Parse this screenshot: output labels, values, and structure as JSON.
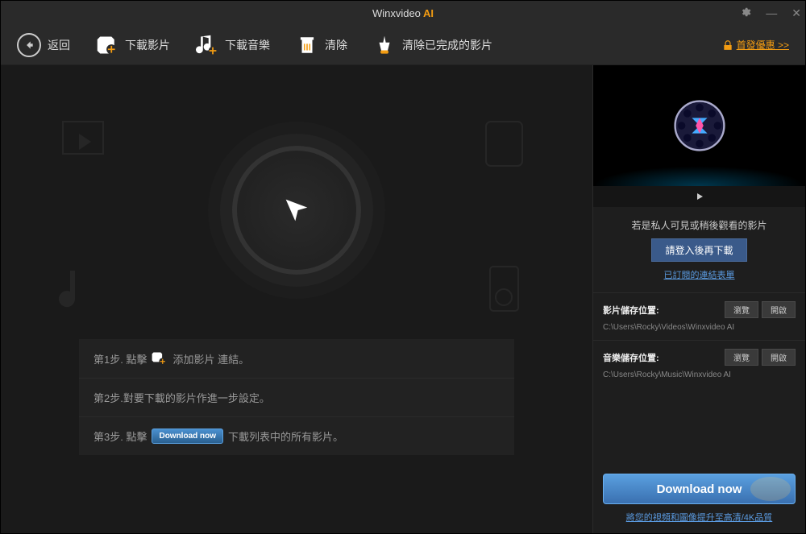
{
  "titlebar": {
    "title_main": "Winxvideo",
    "title_ai": " AI"
  },
  "toolbar": {
    "back": "返回",
    "download_video": "下載影片",
    "download_music": "下載音樂",
    "clear": "清除",
    "clear_completed": "清除已完成的影片",
    "promo": "首發優惠 >>"
  },
  "steps": {
    "s1_prefix": "第1步. 點擊",
    "s1_suffix": "添加影片 連結。",
    "s2": "第2步.對要下載的影片作進一步設定。",
    "s3_prefix": "第3步. 點擊",
    "s3_btn": "Download now",
    "s3_suffix": "下載列表中的所有影片。"
  },
  "sidebar": {
    "login_msg": "若是私人可見或稍後觀看的影片",
    "login_btn": "請登入後再下載",
    "subscribed_link": "已訂閱的連結表單",
    "video_path_label": "影片儲存位置:",
    "video_path": "C:\\Users\\Rocky\\Videos\\Winxvideo AI",
    "music_path_label": "音樂儲存位置:",
    "music_path": "C:\\Users\\Rocky\\Music\\Winxvideo AI",
    "browse": "瀏覽",
    "open": "開啟",
    "download_now": "Download now",
    "upgrade_link": "將您的視頻和圖像提升至高清/4K品質"
  }
}
